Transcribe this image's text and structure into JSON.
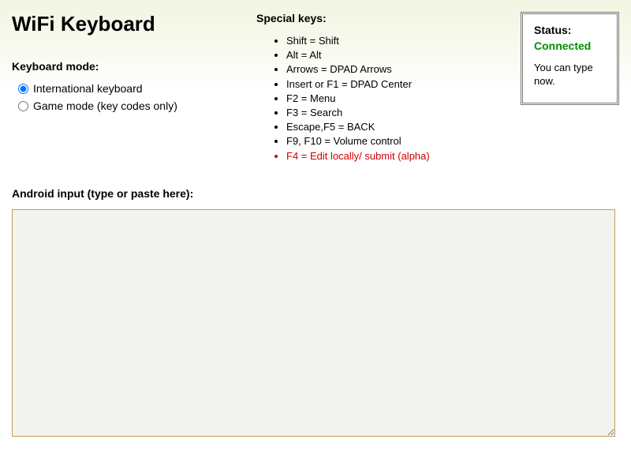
{
  "title": "WiFi Keyboard",
  "keyboard_mode": {
    "heading": "Keyboard mode:",
    "options": [
      "International keyboard",
      "Game mode (key codes only)"
    ],
    "selected_index": 0
  },
  "special_keys": {
    "heading": "Special keys:",
    "items": [
      "Shift = Shift",
      "Alt = Alt",
      "Arrows = DPAD Arrows",
      "Insert or F1 = DPAD Center",
      "F2 = Menu",
      "F3 = Search",
      "Escape,F5 = BACK",
      "F9, F10 = Volume control",
      "F4 = Edit locally/ submit (alpha)"
    ],
    "alpha_index": 8
  },
  "status": {
    "heading": "Status:",
    "value": "Connected",
    "message": "You can type now."
  },
  "input": {
    "heading": "Android input (type or paste here):",
    "value": ""
  }
}
